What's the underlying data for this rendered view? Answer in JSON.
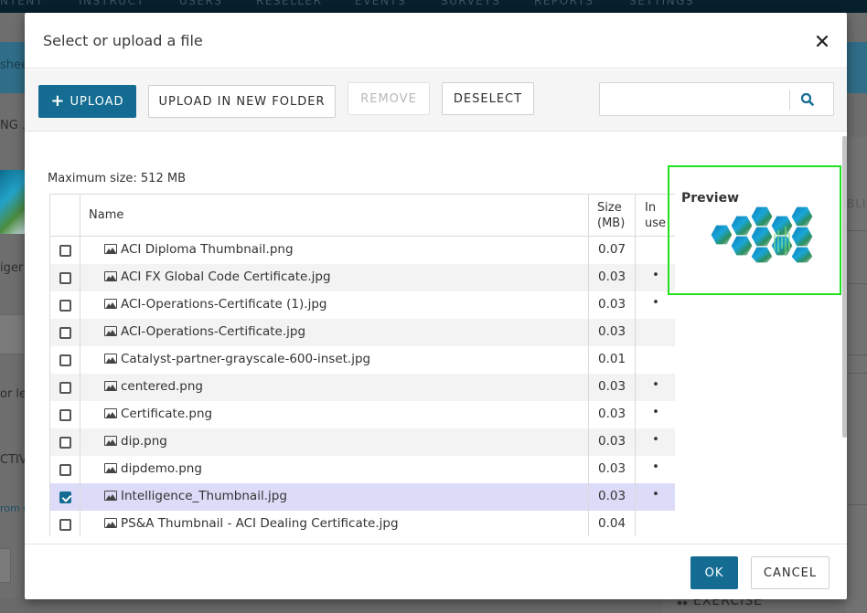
{
  "background": {
    "nav_items": [
      "NTENT",
      "INSTRUCT",
      "USERS",
      "RESELLER",
      "EVENTS",
      "SURVEYS",
      "REPORTS",
      "SETTINGS"
    ],
    "banner_text": "shee",
    "left_texts": [
      "NG .",
      "iger",
      "or lea",
      "CTIV",
      "rom c"
    ],
    "right_text": "BLIS",
    "exercise_label": "EXERCISE"
  },
  "dialog": {
    "title": "Select or upload a file",
    "close_icon": "close-icon"
  },
  "toolbar": {
    "upload_label": "UPLOAD",
    "upload_folder_label": "UPLOAD IN NEW FOLDER",
    "remove_label": "REMOVE",
    "deselect_label": "DESELECT",
    "search_value": "",
    "search_placeholder": "",
    "search_icon": "search-icon"
  },
  "file_list": {
    "max_size_text": "Maximum size: 512 MB",
    "columns": {
      "name": "Name",
      "size_line1": "Size",
      "size_line2": "(MB)",
      "inuse_line1": "In",
      "inuse_line2": "use"
    },
    "rows": [
      {
        "name": "ACI Diploma Thumbnail.png",
        "size": "0.07",
        "in_use": "",
        "checked": false
      },
      {
        "name": "ACI FX Global Code Certificate.jpg",
        "size": "0.03",
        "in_use": "•",
        "checked": false
      },
      {
        "name": "ACI-Operations-Certificate (1).jpg",
        "size": "0.03",
        "in_use": "•",
        "checked": false
      },
      {
        "name": "ACI-Operations-Certificate.jpg",
        "size": "0.03",
        "in_use": "",
        "checked": false
      },
      {
        "name": "Catalyst-partner-grayscale-600-inset.jpg",
        "size": "0.01",
        "in_use": "",
        "checked": false
      },
      {
        "name": "centered.png",
        "size": "0.03",
        "in_use": "•",
        "checked": false
      },
      {
        "name": "Certificate.png",
        "size": "0.03",
        "in_use": "•",
        "checked": false
      },
      {
        "name": "dip.png",
        "size": "0.03",
        "in_use": "•",
        "checked": false
      },
      {
        "name": "dipdemo.png",
        "size": "0.03",
        "in_use": "•",
        "checked": false
      },
      {
        "name": "Intelligence_Thumbnail.jpg",
        "size": "0.03",
        "in_use": "•",
        "checked": true
      },
      {
        "name": "PS&A Thumbnail - ACI Dealing Certificate.jpg",
        "size": "0.04",
        "in_use": "",
        "checked": false
      }
    ]
  },
  "preview": {
    "label": "Preview",
    "highlight_color": "#22e022"
  },
  "footer": {
    "ok_label": "OK",
    "cancel_label": "CANCEL"
  },
  "colors": {
    "primary": "#156c93",
    "selected_row": "#dcdcf9"
  }
}
